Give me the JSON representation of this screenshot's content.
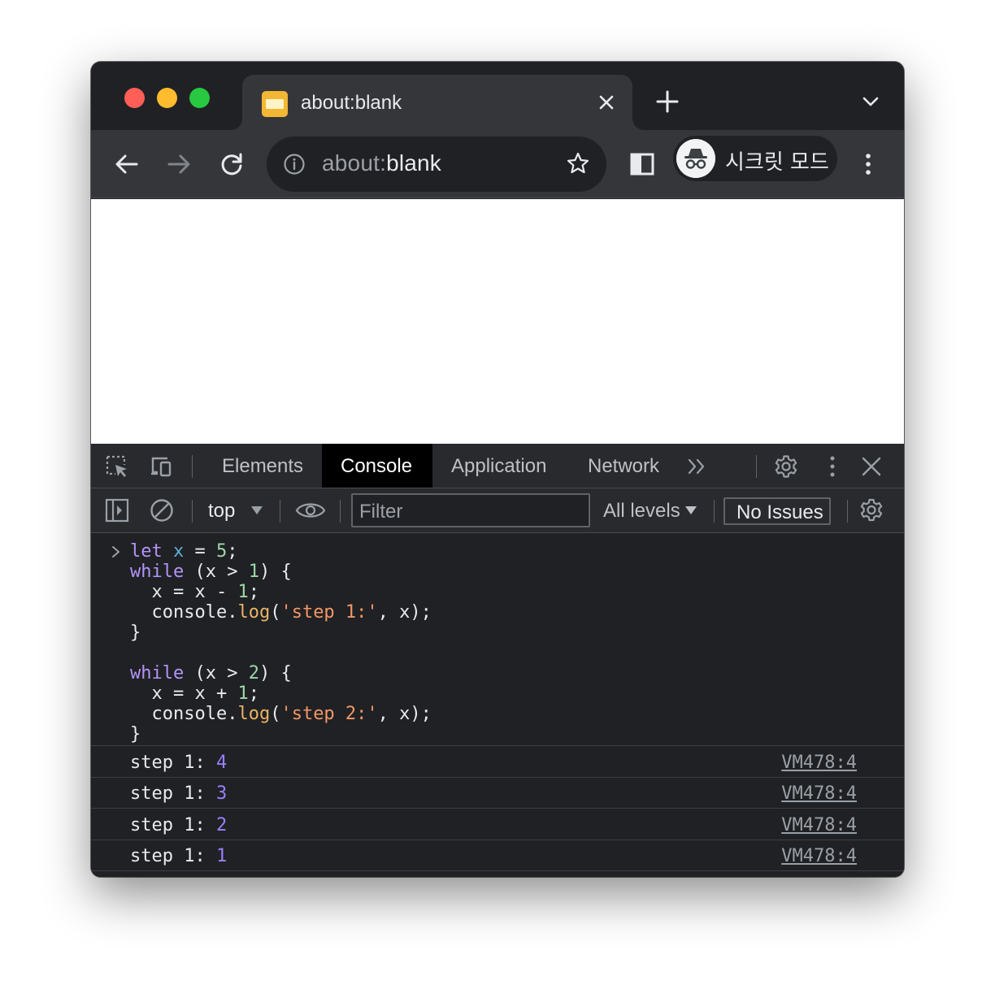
{
  "tab": {
    "title": "about:blank"
  },
  "omnibox": {
    "scheme": "about:",
    "rest": "blank"
  },
  "profile": {
    "label": "시크릿 모드"
  },
  "devtools": {
    "tabs": [
      "Elements",
      "Console",
      "Application",
      "Network"
    ],
    "active_tab": "Console",
    "context": "top",
    "filter_placeholder": "Filter",
    "levels": "All levels",
    "issues": "No Issues"
  },
  "console": {
    "code": {
      "l1": {
        "kw": "let",
        "var": "x",
        "op": " = ",
        "num": "5",
        "end": ";"
      },
      "l2": {
        "kw": "while",
        "open": " (x > ",
        "num": "1",
        "close": ") {"
      },
      "l3": {
        "pre": "  x = x - ",
        "num": "1",
        "end": ";"
      },
      "l4": {
        "pre": "  console.",
        "fn": "log",
        "open": "(",
        "str": "'step 1:'",
        "close": ", x);"
      },
      "l5": "}",
      "l7": {
        "kw": "while",
        "open": " (x > ",
        "num": "2",
        "close": ") {"
      },
      "l8": {
        "pre": "  x = x + ",
        "num": "1",
        "end": ";"
      },
      "l9": {
        "pre": "  console.",
        "fn": "log",
        "open": "(",
        "str": "'step 2:'",
        "close": ", x);"
      },
      "l10": "}"
    },
    "messages": [
      {
        "label": "step 1: ",
        "value": "4",
        "source": "VM478:4"
      },
      {
        "label": "step 1: ",
        "value": "3",
        "source": "VM478:4"
      },
      {
        "label": "step 1: ",
        "value": "2",
        "source": "VM478:4"
      },
      {
        "label": "step 1: ",
        "value": "1",
        "source": "VM478:4"
      }
    ]
  },
  "colors": {
    "window_bg": "#202124",
    "toolbar_bg": "#35363a",
    "console_bg": "#202124",
    "keyword": "#b394f9",
    "number": "#9ed8a7",
    "string": "#f29766",
    "log_number": "#9980ff"
  }
}
